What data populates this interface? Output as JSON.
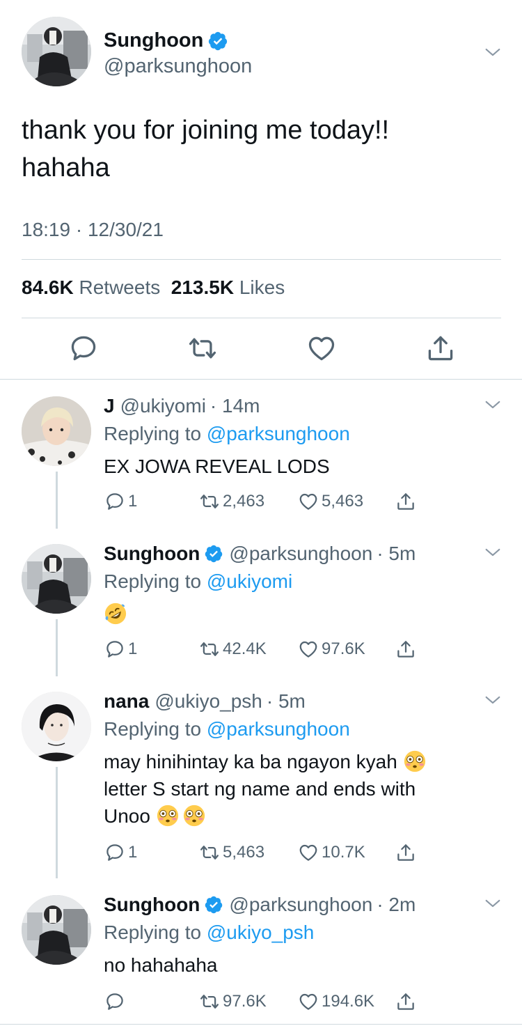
{
  "main_tweet": {
    "display_name": "Sunghoon",
    "handle": "@parksunghoon",
    "text_line1": "thank you for joining me today!!",
    "text_line2": "hahaha",
    "timestamp": "18:19 · 12/30/21",
    "retweets_count": "84.6K",
    "retweets_label": "Retweets",
    "likes_count": "213.5K",
    "likes_label": "Likes"
  },
  "replies": [
    {
      "display_name": "J",
      "handle": "@ukiyomi",
      "time": "· 14m",
      "replying_to_label": "Replying to",
      "replying_to_mention": "@parksunghoon",
      "text": "EX JOWA REVEAL LODS",
      "reply_count": "1",
      "retweet_count": "2,463",
      "like_count": "5,463",
      "verified": false
    },
    {
      "display_name": "Sunghoon",
      "handle": "@parksunghoon",
      "time": "· 5m",
      "replying_to_label": "Replying to",
      "replying_to_mention": "@ukiyomi",
      "text": "",
      "emoji": "rolling-on-floor-laughing-emoji",
      "reply_count": "1",
      "retweet_count": "42.4K",
      "like_count": "97.6K",
      "verified": true
    },
    {
      "display_name": "nana",
      "handle": "@ukiyo_psh",
      "time": "· 5m",
      "replying_to_label": "Replying to",
      "replying_to_mention": "@parksunghoon",
      "text_line1": "may hinihintay ka ba ngayon kyah",
      "text_line2": "letter S start ng name and ends with",
      "text_line3": "Unoo",
      "emoji": "flushed-face-emoji",
      "reply_count": "1",
      "retweet_count": "5,463",
      "like_count": "10.7K",
      "verified": false
    },
    {
      "display_name": "Sunghoon",
      "handle": "@parksunghoon",
      "time": "· 2m",
      "replying_to_label": "Replying to",
      "replying_to_mention": "@ukiyo_psh",
      "text": "no hahahaha",
      "reply_count": "",
      "retweet_count": "97.6K",
      "like_count": "194.6K",
      "verified": true
    }
  ],
  "colors": {
    "accent": "#1d9bf0",
    "secondary_text": "#536471",
    "primary_text": "#0f1419",
    "divider": "#cfd9de"
  }
}
